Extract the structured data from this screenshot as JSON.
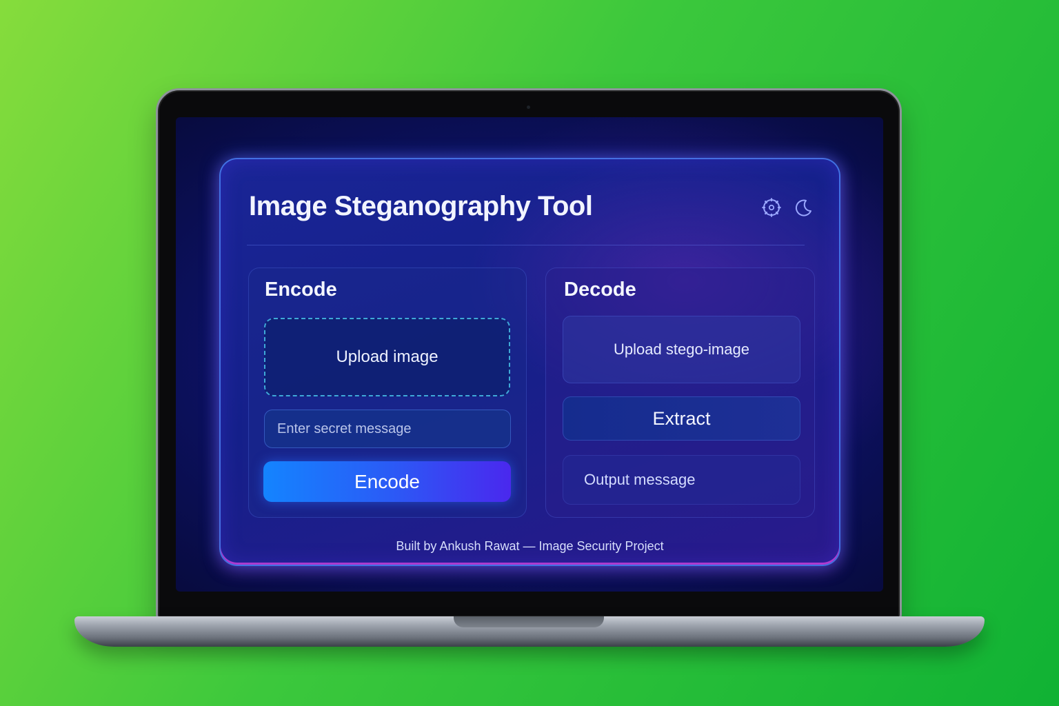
{
  "app": {
    "title": "Image Steganography Tool",
    "header_icons": [
      "settings-icon",
      "moon-icon"
    ]
  },
  "encode": {
    "title": "Encode",
    "upload_label": "Upload image",
    "message_placeholder": "Enter secret message",
    "button_label": "Encode"
  },
  "decode": {
    "title": "Decode",
    "upload_label": "Upload stego-image",
    "button_label": "Extract",
    "output_label": "Output message"
  },
  "footer": {
    "text": "Built by Ankush Rawat — Image Security Project"
  },
  "colors": {
    "background_green": "#2fc23a",
    "accent_blue": "#1484ff",
    "accent_violet": "#4a28ee",
    "dashed_border": "#3fa9d8"
  }
}
